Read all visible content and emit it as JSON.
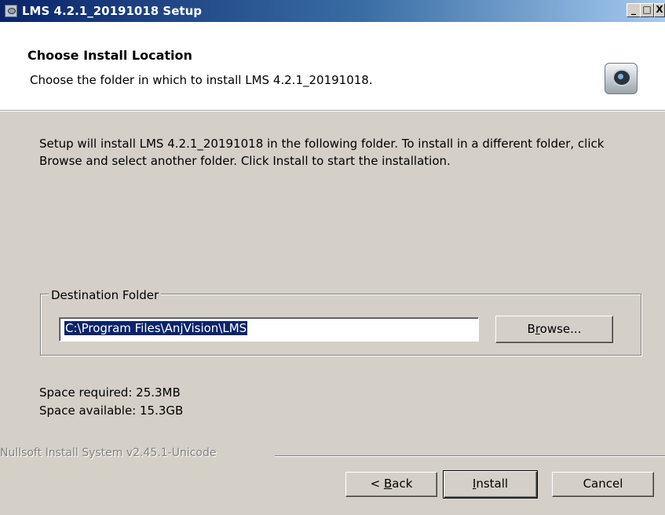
{
  "window": {
    "title": "LMS 4.2.1_20191018 Setup",
    "controls": {
      "minimize": "_",
      "maximize": "□",
      "close": "X"
    }
  },
  "header": {
    "title": "Choose Install Location",
    "subtitle": "Choose the folder in which to install LMS 4.2.1_20191018."
  },
  "body": {
    "description": "Setup will install LMS 4.2.1_20191018 in the following folder. To install in a different folder, click Browse and select another folder. Click Install to start the installation."
  },
  "destination": {
    "legend": "Destination Folder",
    "path": "C:\\Program Files\\AnjVision\\LMS",
    "browse_label_pre": "B",
    "browse_label_ul": "r",
    "browse_label_post": "owse..."
  },
  "space": {
    "required": "Space required: 25.3MB",
    "available": "Space available: 15.3GB"
  },
  "footer": {
    "branding": "Nullsoft Install System v2.45.1-Unicode",
    "back_pre": "< ",
    "back_ul": "B",
    "back_post": "ack",
    "install_ul": "I",
    "install_post": "nstall",
    "cancel_label": "Cancel"
  },
  "colors": {
    "titlebar_start": "#0a246a",
    "titlebar_end": "#a6caf0",
    "dialog_bg": "#d4d0c8",
    "selection": "#0a246a"
  },
  "icons": {
    "title": "webcam-app-icon",
    "header": "webcam-icon"
  }
}
